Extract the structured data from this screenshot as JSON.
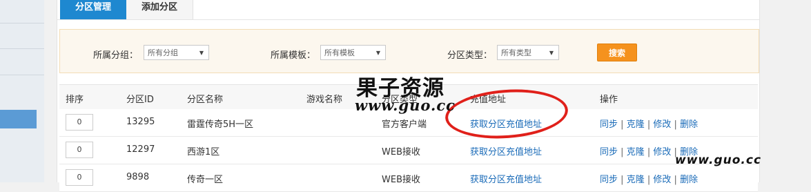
{
  "tabs": [
    {
      "label": "分区管理",
      "active": true
    },
    {
      "label": "添加分区",
      "active": false
    }
  ],
  "filters": {
    "group": {
      "label": "所属分组：",
      "value": "所有分组"
    },
    "template": {
      "label": "所属模板：",
      "value": "所有模板"
    },
    "type": {
      "label": "分区类型：",
      "value": "所有类型"
    },
    "search_label": "搜索"
  },
  "table": {
    "headers": [
      "排序",
      "分区ID",
      "分区名称",
      "游戏名称",
      "分区类型",
      "充值地址",
      "操作"
    ],
    "rows": [
      {
        "sort": "0",
        "id": "13295",
        "name": "雷霆传奇5H一区",
        "game": "",
        "type": "官方客户端",
        "recharge": "获取分区充值地址"
      },
      {
        "sort": "0",
        "id": "12297",
        "name": "西游1区",
        "game": "",
        "type": "WEB接收",
        "recharge": "获取分区充值地址"
      },
      {
        "sort": "0",
        "id": "9898",
        "name": "传奇一区",
        "game": "",
        "type": "WEB接收",
        "recharge": "获取分区充值地址"
      }
    ],
    "actions": {
      "sync": "同步",
      "clone": "克隆",
      "edit": "修改",
      "delete": "删除",
      "separator": "|"
    }
  },
  "watermark": {
    "title": "果子资源",
    "url": "www.guo.cc",
    "url_corner": "www.guo.cc"
  },
  "colors": {
    "accent": "#1e88d0",
    "search_button": "#f5921e",
    "link": "#1a6bb8",
    "annotation": "#e0201a"
  }
}
